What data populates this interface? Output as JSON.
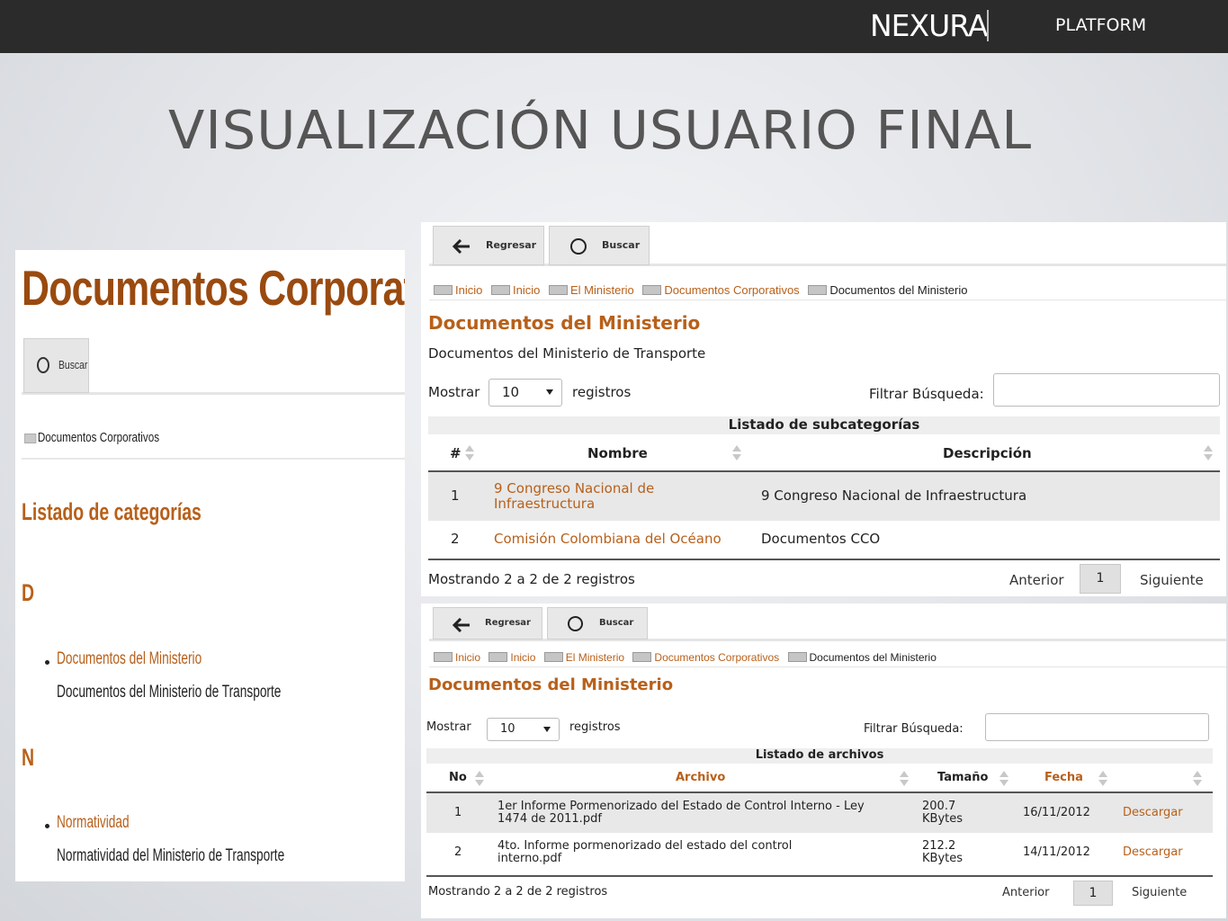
{
  "header": {
    "logo": "NEXURA",
    "platform": "PLATFORM"
  },
  "slide_title": "VISUALIZACIÓN USUARIO FINAL",
  "left": {
    "title": "Documentos Corporativos",
    "search_label": "Buscar",
    "breadcrumb": "Documentos Corporativos",
    "heading": "Listado de categorías",
    "groups": [
      {
        "letter": "D",
        "link": "Documentos del Ministerio",
        "desc": "Documentos del Ministerio de Transporte"
      },
      {
        "letter": "N",
        "link": "Normatividad",
        "desc": "Normatividad del Ministerio de Transporte"
      }
    ]
  },
  "panel1": {
    "back_label": "Regresar",
    "search_label": "Buscar",
    "breadcrumb": [
      "Inicio",
      "Inicio",
      "El Ministerio",
      "Documentos Corporativos",
      "Documentos del Ministerio"
    ],
    "heading": "Documentos del Ministerio",
    "subtitle": "Documentos del Ministerio de Transporte",
    "show_label": "Mostrar",
    "page_size": "10",
    "records_label": "registros",
    "filter_label": "Filtrar Búsqueda:",
    "filter_value": "",
    "table_caption": "Listado de subcategorías",
    "columns": [
      "#",
      "Nombre",
      "Descripción"
    ],
    "rows": [
      {
        "num": "1",
        "name": "9 Congreso Nacional de Infraestructura",
        "desc": "9 Congreso Nacional de Infraestructura"
      },
      {
        "num": "2",
        "name": "Comisión Colombiana del Océano",
        "desc": "Documentos CCO"
      }
    ],
    "footer": "Mostrando 2 a 2 de 2 registros",
    "prev": "Anterior",
    "page": "1",
    "next": "Siguiente"
  },
  "panel2": {
    "back_label": "Regresar",
    "search_label": "Buscar",
    "breadcrumb": [
      "Inicio",
      "Inicio",
      "El Ministerio",
      "Documentos Corporativos",
      "Documentos del Ministerio"
    ],
    "heading": "Documentos del Ministerio",
    "show_label": "Mostrar",
    "page_size": "10",
    "records_label": "registros",
    "filter_label": "Filtrar Búsqueda:",
    "filter_value": "",
    "table_caption": "Listado de archivos",
    "columns": [
      "No",
      "Archivo",
      "Tamaño",
      "Fecha",
      ""
    ],
    "rows": [
      {
        "num": "1",
        "file": "1er Informe Pormenorizado del Estado de Control Interno - Ley 1474 de 2011.pdf",
        "size": "200.7 KBytes",
        "date": "16/11/2012",
        "action": "Descargar"
      },
      {
        "num": "2",
        "file": "4to. Informe pormenorizado del estado del control interno.pdf",
        "size": "212.2 KBytes",
        "date": "14/11/2012",
        "action": "Descargar"
      }
    ],
    "footer": "Mostrando 2 a 2 de 2 registros",
    "prev": "Anterior",
    "page": "1",
    "next": "Siguiente"
  },
  "colors": {
    "accent": "#b8601a",
    "title_brown": "#9a4a0f",
    "topbar": "#2b2b2b"
  }
}
